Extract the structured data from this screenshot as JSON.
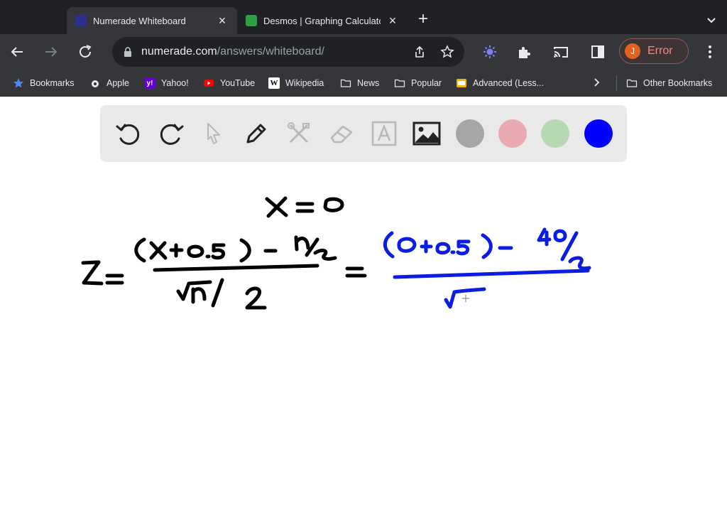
{
  "tabs": [
    {
      "title": "Numerade Whiteboard",
      "active": true
    },
    {
      "title": "Desmos | Graphing Calculato",
      "active": false
    }
  ],
  "omnibox": {
    "domain": "numerade.com",
    "path": "/answers/whiteboard/"
  },
  "profile": {
    "initial": "J",
    "label": "Error"
  },
  "bookmarks": [
    {
      "label": "Bookmarks",
      "icon": "star-icon"
    },
    {
      "label": "Apple",
      "icon": "apple-icon"
    },
    {
      "label": "Yahoo!",
      "icon": "yahoo-icon"
    },
    {
      "label": "YouTube",
      "icon": "youtube-icon"
    },
    {
      "label": "Wikipedia",
      "icon": "wikipedia-icon"
    },
    {
      "label": "News",
      "icon": "folder-icon"
    },
    {
      "label": "Popular",
      "icon": "folder-icon"
    },
    {
      "label": "Advanced (Less...",
      "icon": "bookmark-icon"
    }
  ],
  "other_bookmarks": "Other Bookmarks",
  "whiteboard": {
    "tools": [
      "undo-icon",
      "redo-icon",
      "pointer-icon",
      "pen-icon",
      "tools-icon",
      "eraser-icon",
      "text-icon",
      "image-icon"
    ],
    "colors": [
      "#a6a6a6",
      "#e8aab0",
      "#b6d9b4",
      "#0000ff"
    ],
    "selected_color": "#0000ff"
  }
}
